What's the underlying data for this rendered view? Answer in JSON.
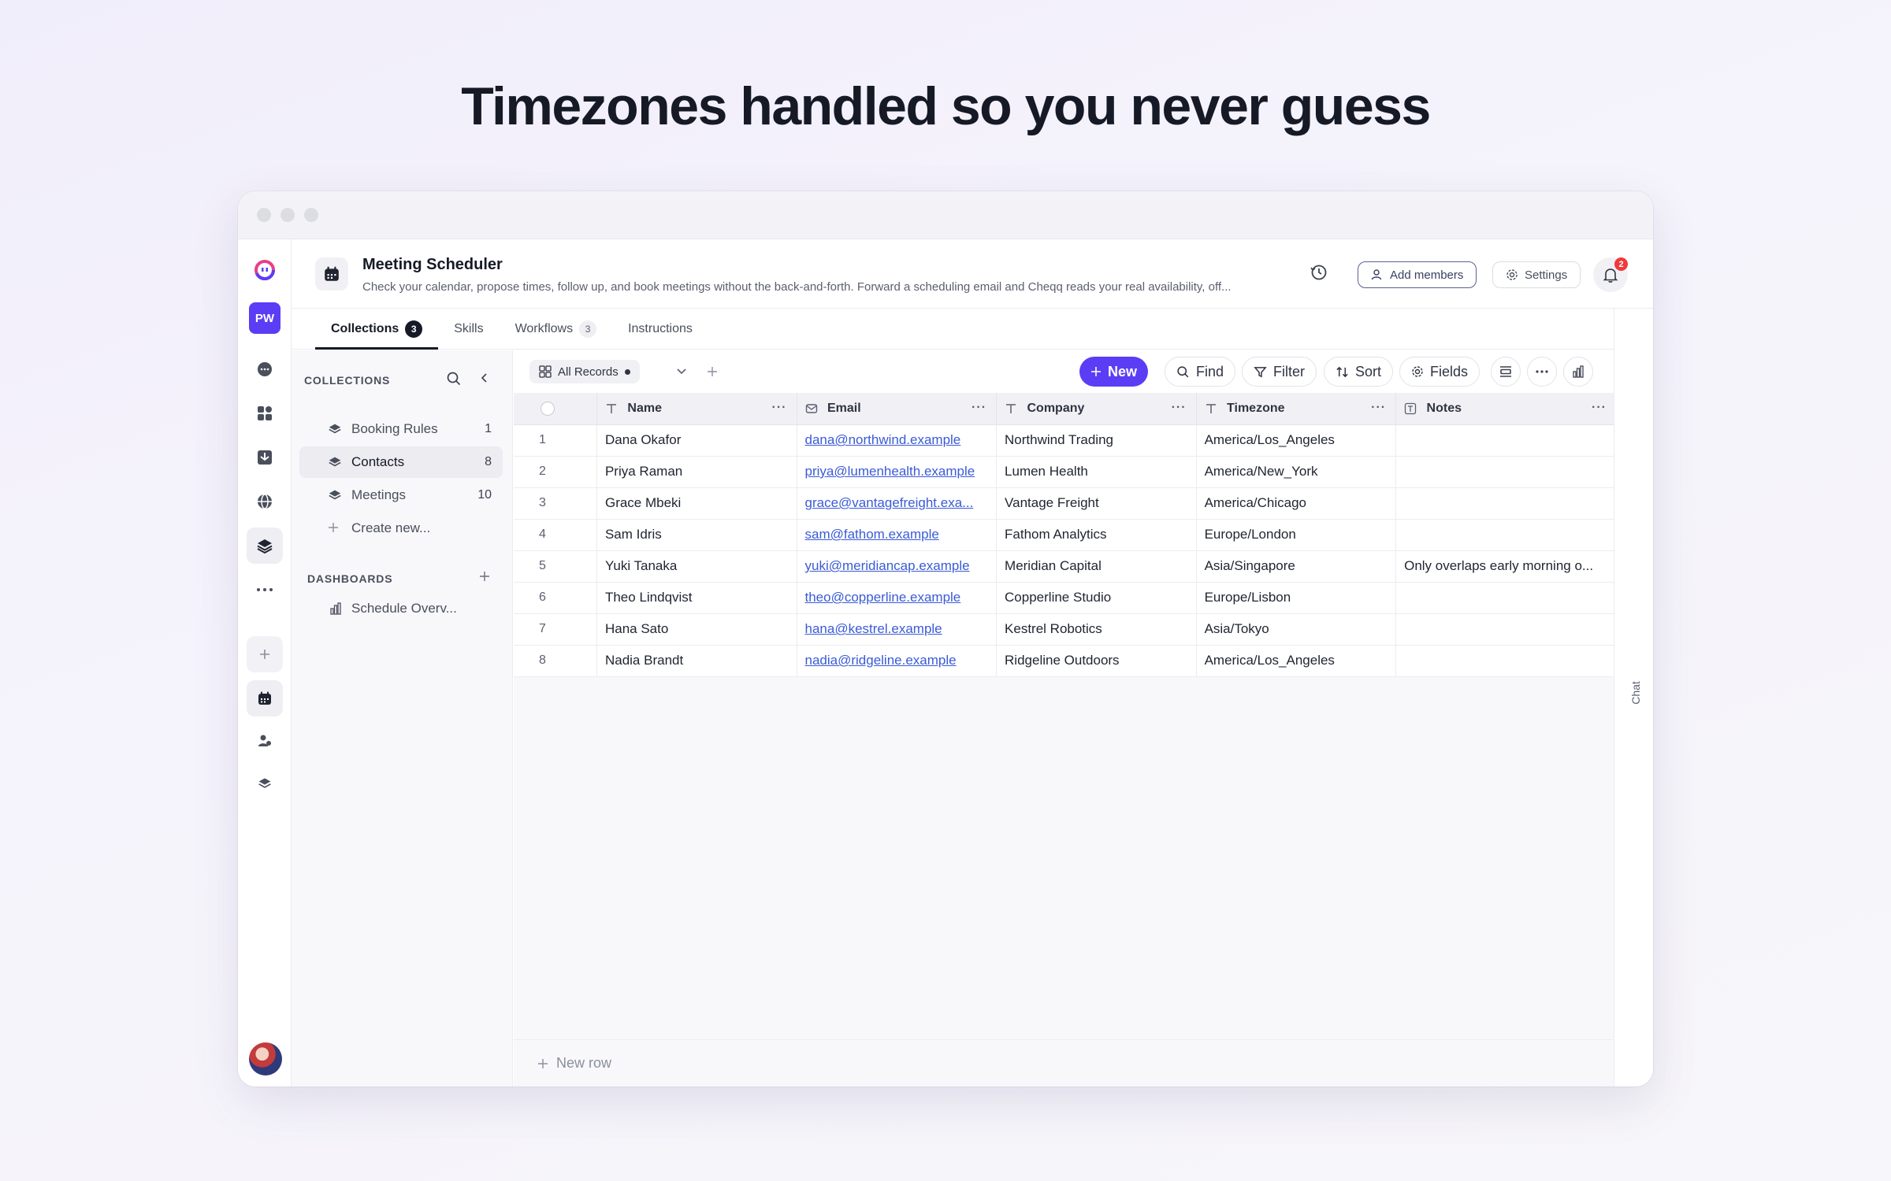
{
  "hero_title": "Timezones handled so you never guess",
  "rail": {
    "workspace_initials": "PW"
  },
  "header": {
    "title": "Meeting Scheduler",
    "description": "Check your calendar, propose times, follow up, and book meetings without the back-and-forth. Forward a scheduling email and Cheqq reads your real availability, off...",
    "add_members": "Add members",
    "settings": "Settings",
    "notification_count": "2"
  },
  "tabs": [
    {
      "label": "Collections",
      "count": "3"
    },
    {
      "label": "Skills",
      "count": ""
    },
    {
      "label": "Workflows",
      "count": "3"
    },
    {
      "label": "Instructions",
      "count": ""
    }
  ],
  "collections_panel": {
    "heading": "COLLECTIONS",
    "items": [
      {
        "label": "Booking Rules",
        "count": "1"
      },
      {
        "label": "Contacts",
        "count": "8"
      },
      {
        "label": "Meetings",
        "count": "10"
      }
    ],
    "create_new": "Create new...",
    "dashboards_heading": "DASHBOARDS",
    "dashboards": [
      {
        "label": "Schedule Overv..."
      }
    ]
  },
  "toolbar": {
    "view_name": "All Records",
    "new": "New",
    "find": "Find",
    "filter": "Filter",
    "sort": "Sort",
    "fields": "Fields"
  },
  "table": {
    "columns": [
      "Name",
      "Email",
      "Company",
      "Timezone",
      "Notes"
    ],
    "rows": [
      {
        "n": "1",
        "name": "Dana Okafor",
        "email": "dana@northwind.example",
        "company": "Northwind Trading",
        "timezone": "America/Los_Angeles",
        "notes": ""
      },
      {
        "n": "2",
        "name": "Priya Raman",
        "email": "priya@lumenhealth.example",
        "company": "Lumen Health",
        "timezone": "America/New_York",
        "notes": ""
      },
      {
        "n": "3",
        "name": "Grace Mbeki",
        "email": "grace@vantagefreight.exa...",
        "company": "Vantage Freight",
        "timezone": "America/Chicago",
        "notes": ""
      },
      {
        "n": "4",
        "name": "Sam Idris",
        "email": "sam@fathom.example",
        "company": "Fathom Analytics",
        "timezone": "Europe/London",
        "notes": ""
      },
      {
        "n": "5",
        "name": "Yuki Tanaka",
        "email": "yuki@meridiancap.example",
        "company": "Meridian Capital",
        "timezone": "Asia/Singapore",
        "notes": "Only overlaps early morning o..."
      },
      {
        "n": "6",
        "name": "Theo Lindqvist",
        "email": "theo@copperline.example",
        "company": "Copperline Studio",
        "timezone": "Europe/Lisbon",
        "notes": ""
      },
      {
        "n": "7",
        "name": "Hana Sato",
        "email": "hana@kestrel.example",
        "company": "Kestrel Robotics",
        "timezone": "Asia/Tokyo",
        "notes": ""
      },
      {
        "n": "8",
        "name": "Nadia Brandt",
        "email": "nadia@ridgeline.example",
        "company": "Ridgeline Outdoors",
        "timezone": "America/Los_Angeles",
        "notes": ""
      }
    ],
    "new_row": "New row"
  },
  "chat_label": "Chat"
}
